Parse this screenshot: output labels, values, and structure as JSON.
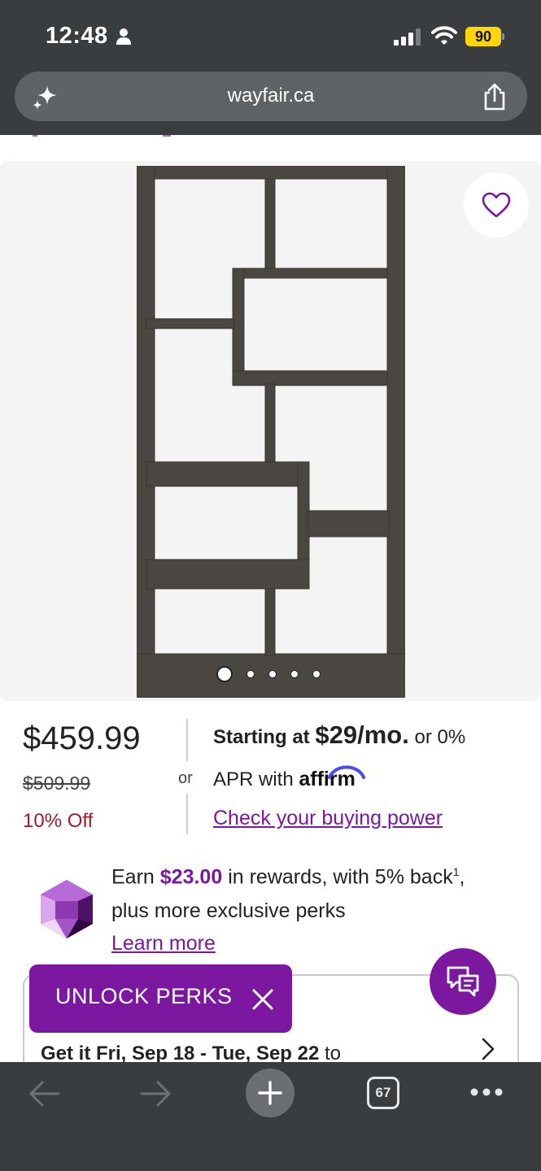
{
  "status_bar": {
    "time": "12:48",
    "battery_level": "90"
  },
  "browser": {
    "url": "wayfair.ca",
    "tab_count": "67",
    "icons": [
      "sparkle-icon",
      "share-icon",
      "back-icon",
      "forward-icon",
      "plus-icon",
      "more-icon"
    ]
  },
  "product": {
    "image_count": 5,
    "active_image_index": 0
  },
  "pricing": {
    "price": "$459.99",
    "was_price": "$509.99",
    "discount": "10% Off",
    "or": "or",
    "financing_prefix": "Starting at",
    "financing_amount": "$29/mo.",
    "financing_suffix": "or 0%",
    "apr_text": "APR with",
    "affirm_logo_text": "affirm",
    "buying_power_link": "Check your buying power"
  },
  "rewards": {
    "earn_prefix": "Earn",
    "amount": "$23.00",
    "earn_suffix": "in rewards, with 5% back",
    "footnote_mark": "1",
    "earn_end": ",",
    "line2": "plus more exclusive perks",
    "learn_more": "Learn more"
  },
  "delivery": {
    "prefix": "Get it Fri, Sep 18 - Tue, Sep 22",
    "suffix": "to"
  },
  "unlock_perks": {
    "label": "UNLOCK PERKS"
  },
  "colors": {
    "accent_purple": "#7b189f",
    "discount_red": "#9b1c2e",
    "chrome_dark": "#3a3d3f",
    "battery_yellow": "#ffd60a"
  }
}
